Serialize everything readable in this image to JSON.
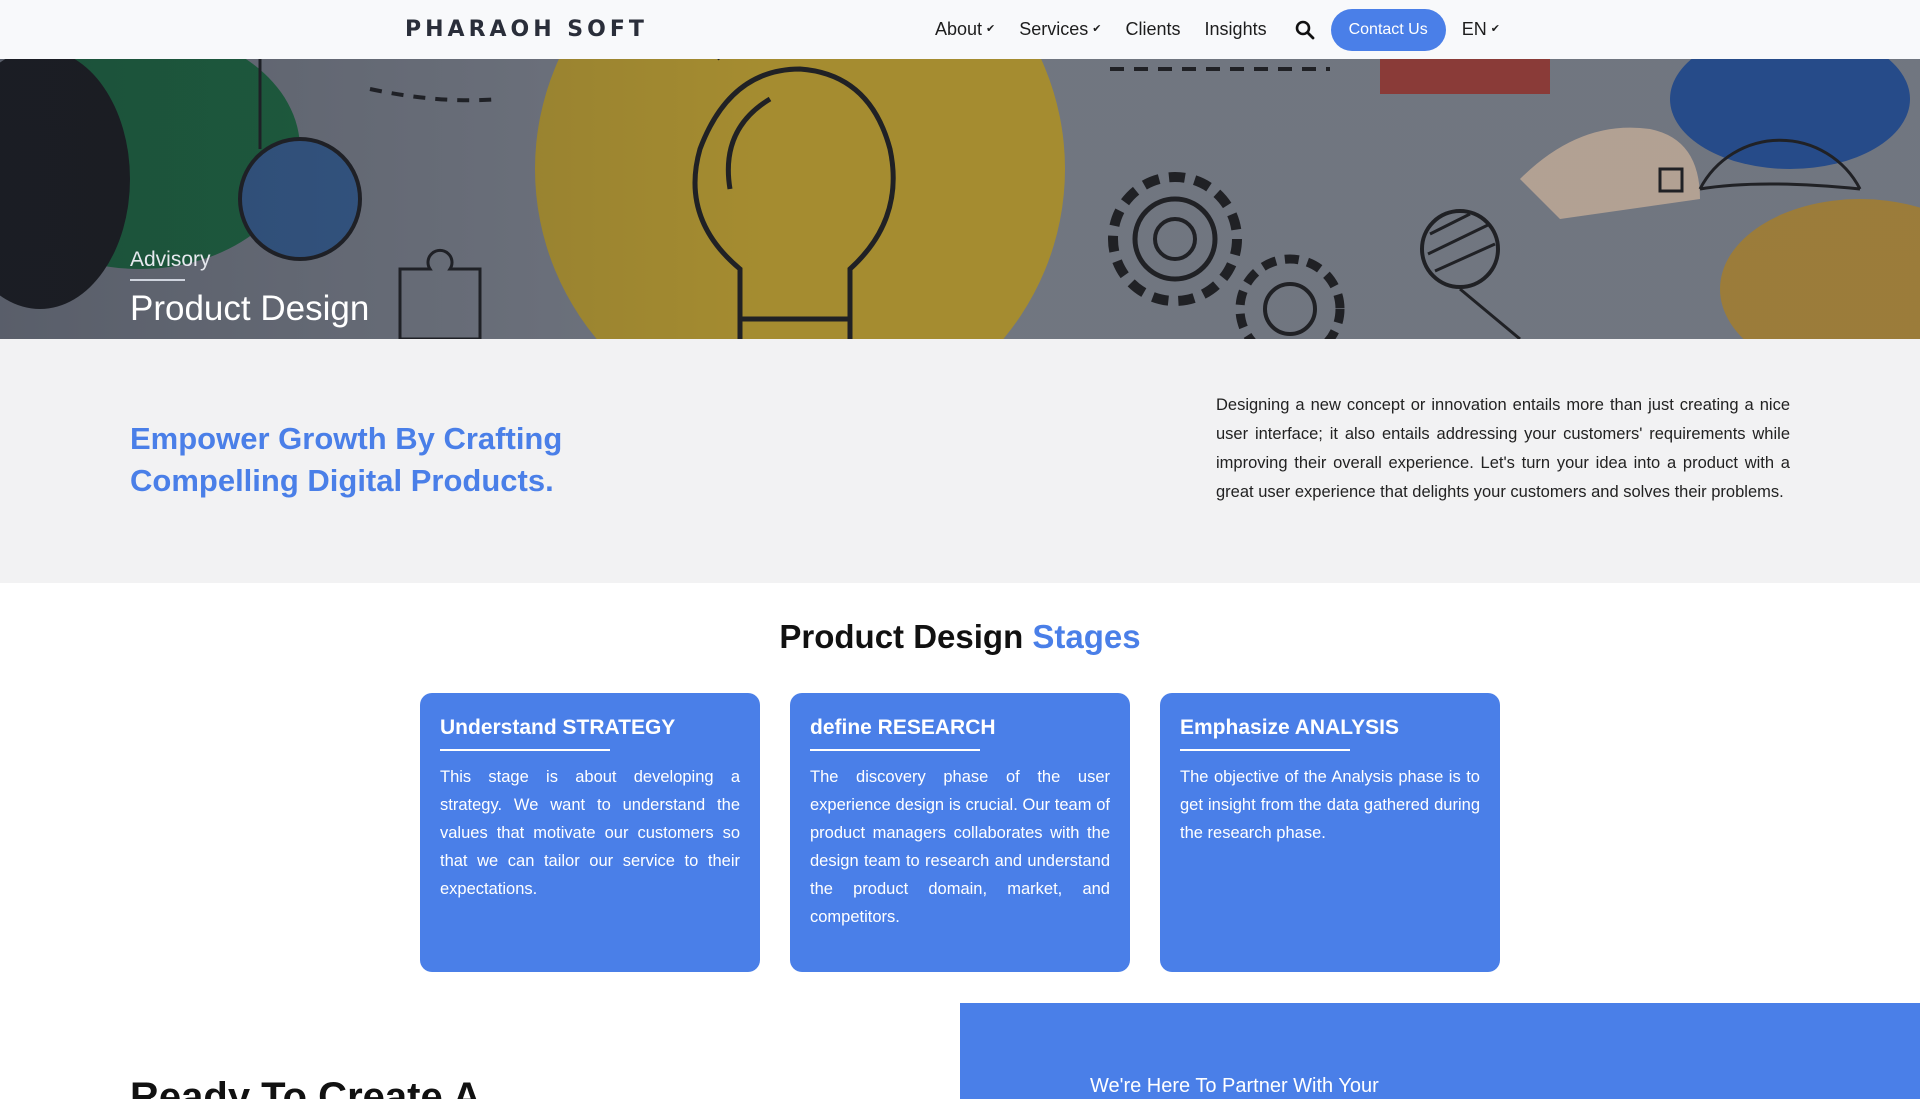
{
  "nav": {
    "logo": "PHARAOH SOFT",
    "items": [
      {
        "label": "About",
        "has_dropdown": true
      },
      {
        "label": "Services",
        "has_dropdown": true
      },
      {
        "label": "Clients",
        "has_dropdown": false
      },
      {
        "label": "Insights",
        "has_dropdown": false
      }
    ],
    "search_icon": "search-icon",
    "contact_label": "Contact Us",
    "language": "EN"
  },
  "hero": {
    "kicker": "Advisory",
    "title": "Product Design"
  },
  "intro": {
    "heading": "Empower Growth By Crafting Compelling Digital Products.",
    "text": "Designing a new concept or innovation entails more than just creating a nice user interface; it also entails addressing your customers' requirements while improving their overall experience. Let's turn your idea into a product with a great user experience that delights your customers and solves their problems."
  },
  "stages": {
    "title_main": "Product Design",
    "title_accent": "Stages",
    "cards": [
      {
        "title": "Understand STRATEGY",
        "text": "This stage is about developing a strategy. We want to understand the values that motivate our customers so that we can tailor our service to their expectations."
      },
      {
        "title": "define RESEARCH",
        "text": "The discovery phase of the user experience design is crucial. Our team of product managers collaborates with the design team to research and understand the product domain, market, and competitors."
      },
      {
        "title": "Emphasize ANALYSIS",
        "text": "The objective of the Analysis phase is to get insight from the data gathered during the research phase."
      }
    ]
  },
  "cta": {
    "heading": "Ready To Create A",
    "partner_text": "We're Here To Partner With Your"
  },
  "colors": {
    "accent": "#4a7fe8",
    "intro_bg": "#f2f2f3",
    "nav_bg": "#f8f9fb"
  }
}
